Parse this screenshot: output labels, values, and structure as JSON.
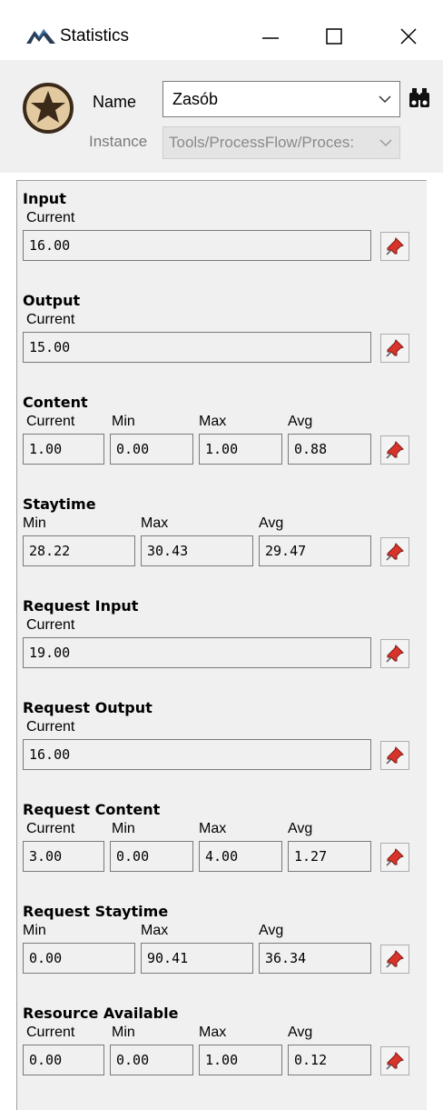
{
  "window": {
    "title": "Statistics",
    "minimize_label": "—",
    "maximize_label": "☐",
    "close_label": "✕"
  },
  "header": {
    "name_label": "Name",
    "name_value": "Zasób",
    "instance_label": "Instance",
    "instance_value": "Tools/ProcessFlow/Proces:"
  },
  "sections": {
    "input": {
      "title": "Input",
      "labels": {
        "current": "Current"
      },
      "values": {
        "current": "16.00"
      }
    },
    "output": {
      "title": "Output",
      "labels": {
        "current": "Current"
      },
      "values": {
        "current": "15.00"
      }
    },
    "content": {
      "title": "Content",
      "labels": {
        "current": "Current",
        "min": "Min",
        "max": "Max",
        "avg": "Avg"
      },
      "values": {
        "current": "1.00",
        "min": "0.00",
        "max": "1.00",
        "avg": "0.88"
      }
    },
    "staytime": {
      "title": "Staytime",
      "labels": {
        "min": "Min",
        "max": "Max",
        "avg": "Avg"
      },
      "values": {
        "min": "28.22",
        "max": "30.43",
        "avg": "29.47"
      }
    },
    "request_input": {
      "title": "Request Input",
      "labels": {
        "current": "Current"
      },
      "values": {
        "current": "19.00"
      }
    },
    "request_output": {
      "title": "Request Output",
      "labels": {
        "current": "Current"
      },
      "values": {
        "current": "16.00"
      }
    },
    "request_content": {
      "title": "Request Content",
      "labels": {
        "current": "Current",
        "min": "Min",
        "max": "Max",
        "avg": "Avg"
      },
      "values": {
        "current": "3.00",
        "min": "0.00",
        "max": "4.00",
        "avg": "1.27"
      }
    },
    "request_staytime": {
      "title": "Request Staytime",
      "labels": {
        "min": "Min",
        "max": "Max",
        "avg": "Avg"
      },
      "values": {
        "min": "0.00",
        "max": "90.41",
        "avg": "36.34"
      }
    },
    "resource_available": {
      "title": "Resource Available",
      "labels": {
        "current": "Current",
        "min": "Min",
        "max": "Max",
        "avg": "Avg"
      },
      "values": {
        "current": "0.00",
        "min": "0.00",
        "max": "1.00",
        "avg": "0.12"
      }
    }
  },
  "icons": {
    "app": "flexsim-logo-icon",
    "object": "star-badge-icon",
    "find": "binoculars-icon",
    "pin": "pushpin-icon"
  },
  "colors": {
    "panel_bg": "#f0f0f0",
    "badge_fill": "#e3c9a0",
    "badge_ring": "#3b2a1a",
    "pin_red": "#d9342b"
  }
}
